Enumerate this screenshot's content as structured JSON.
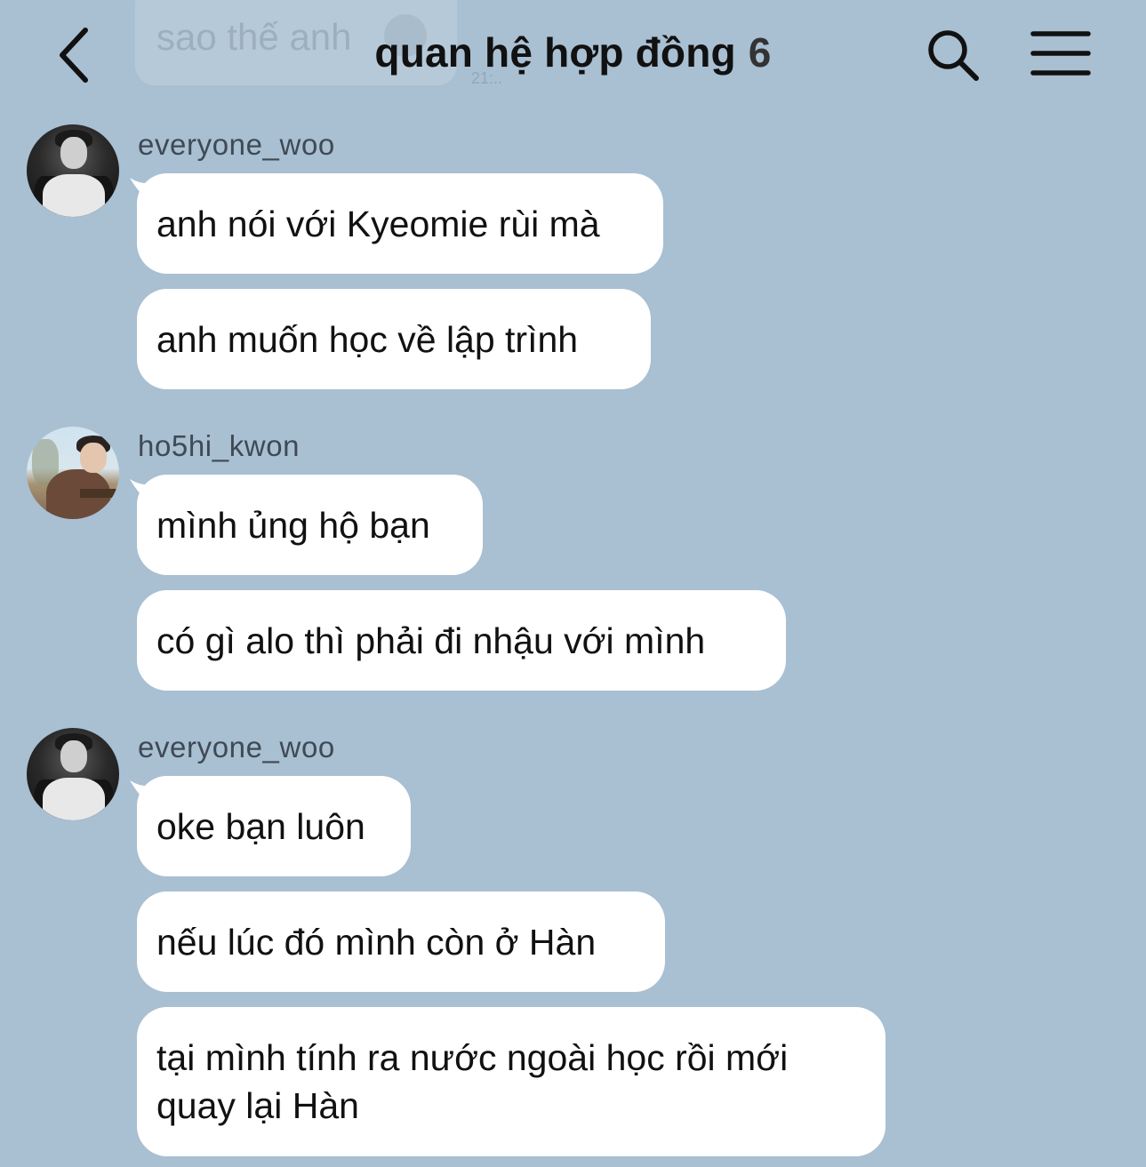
{
  "header": {
    "title": "quan hệ hợp đồng",
    "member_count": "6",
    "ghost_message": "sao thế anh",
    "ghost_time": "21:..",
    "back_icon": "chevron-left-icon",
    "search_icon": "search-icon",
    "menu_icon": "hamburger-menu-icon"
  },
  "messages": [
    {
      "username": "everyone_woo",
      "avatar": "avatar-dark",
      "bubbles": [
        "anh nói với Kyeomie rùi mà",
        "anh muốn học về lập trình"
      ]
    },
    {
      "username": "ho5hi_kwon",
      "avatar": "avatar-outdoor",
      "bubbles": [
        "mình ủng hộ bạn",
        "có gì alo thì phải đi nhậu với mình"
      ]
    },
    {
      "username": "everyone_woo",
      "avatar": "avatar-dark",
      "bubbles": [
        "oke bạn luôn",
        "nếu lúc đó mình còn ở Hàn",
        "tại mình tính ra nước ngoài học rồi mới quay lại Hàn"
      ]
    }
  ],
  "colors": {
    "background": "#a9bfd2",
    "bubble": "#ffffff",
    "username": "#3e4a55",
    "title": "#111111"
  }
}
